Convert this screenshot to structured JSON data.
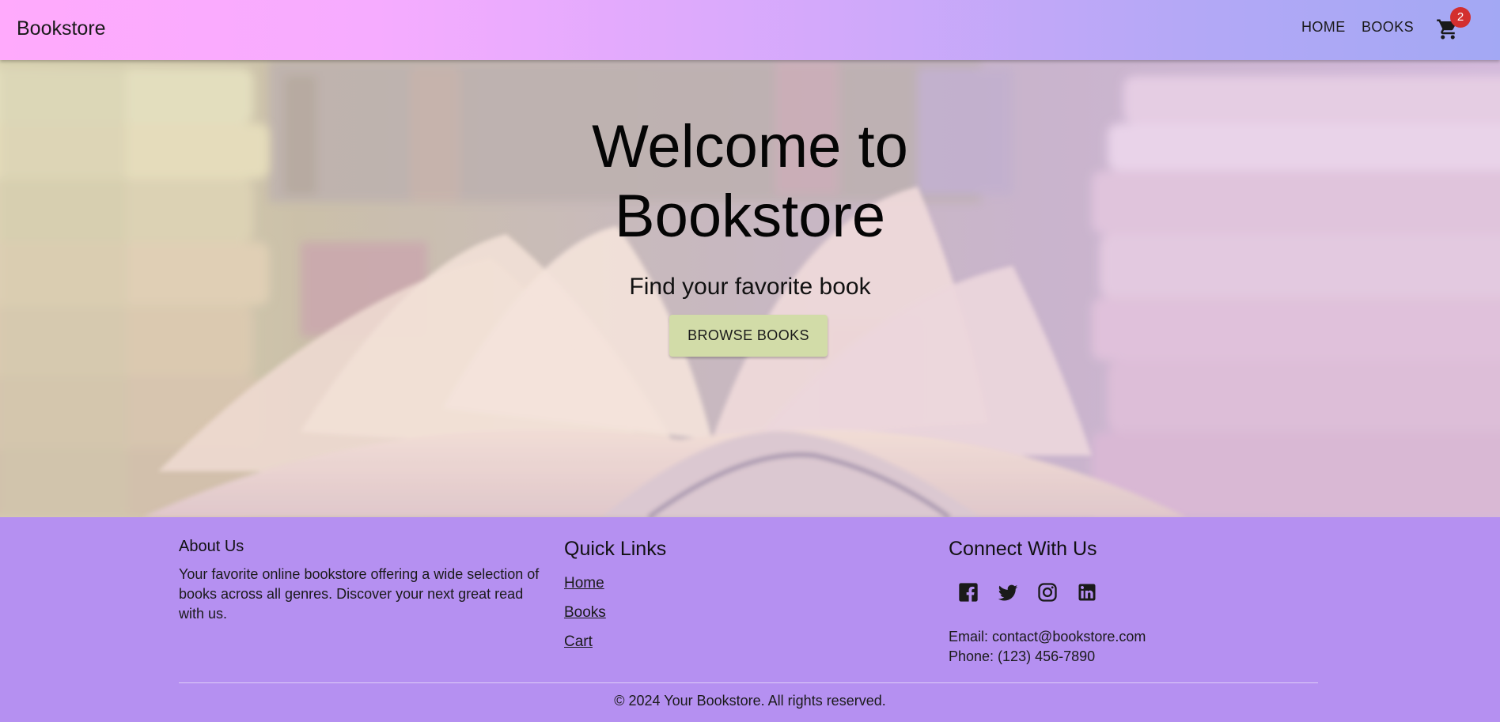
{
  "header": {
    "brand": "Bookstore",
    "nav": [
      {
        "label": "HOME"
      },
      {
        "label": "BOOKS"
      }
    ],
    "cart": {
      "icon": "shopping-cart-icon",
      "badge_count": "2",
      "badge_color": "#d32f2f"
    }
  },
  "hero": {
    "title": "Welcome to Bookstore",
    "subtitle": "Find your favorite book",
    "cta_label": "BROWSE BOOKS",
    "cta_color": "#d2dca8"
  },
  "footer": {
    "background": "#b590f1",
    "about": {
      "title": "About Us",
      "text": "Your favorite online bookstore offering a wide selection of books across all genres. Discover your next great read with us."
    },
    "quick_links": {
      "title": "Quick Links",
      "links": [
        {
          "label": "Home"
        },
        {
          "label": "Books"
        },
        {
          "label": "Cart"
        }
      ]
    },
    "connect": {
      "title": "Connect With Us",
      "social_icons": [
        "facebook-icon",
        "twitter-icon",
        "instagram-icon",
        "linkedin-icon"
      ],
      "email": "Email: contact@bookstore.com",
      "phone": "Phone: (123) 456-7890"
    },
    "copyright": "© 2024 Your Bookstore. All rights reserved."
  }
}
